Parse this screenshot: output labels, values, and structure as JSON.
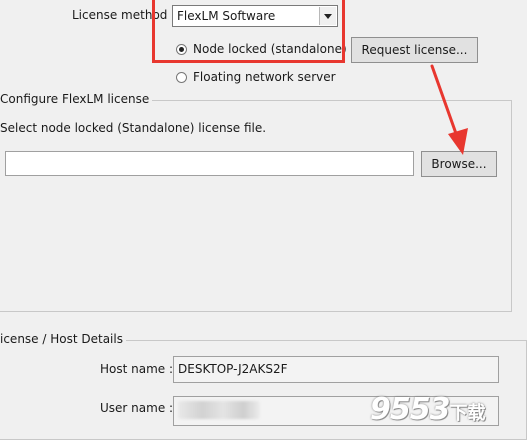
{
  "license_method": {
    "label": "License method :",
    "selected": "FlexLM Software",
    "options": {
      "node_locked": "Node locked (standalone)",
      "floating": "Floating network server"
    },
    "request_button": "Request license..."
  },
  "configure_group": {
    "title": "Configure FlexLM license",
    "instruction": "Select node locked (Standalone) license file.",
    "path_value": "",
    "browse_button": "Browse..."
  },
  "host_group": {
    "title": "icense / Host Details",
    "host_name_label": "Host name :",
    "host_name_value": "DESKTOP-J2AKS2F",
    "user_name_label": "User name :",
    "user_name_value": ""
  },
  "annotation": {
    "highlight_color": "#e8372f"
  },
  "watermark": {
    "number": "9553",
    "suffix": "下载"
  }
}
